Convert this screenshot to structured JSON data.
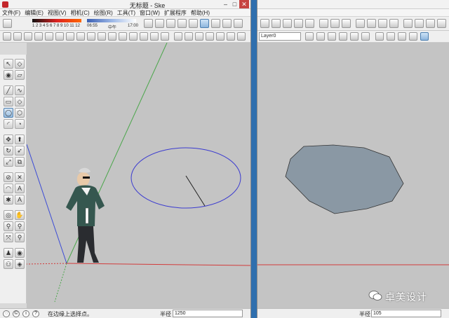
{
  "left_window": {
    "title": "无标题 - Ske",
    "menu": [
      "文件(F)",
      "编辑(E)",
      "视图(V)",
      "相机(C)",
      "绘图(R)",
      "工具(T)",
      "窗口(W)",
      "扩展程序",
      "帮助(H)"
    ],
    "scale_labels": {
      "a": "1 2 3 4 5 6 7 8 9 10 11 12",
      "b": "06:55",
      "c": "中午",
      "d": "17:00"
    },
    "status": {
      "hint": "在边缘上选择点。",
      "radius_label": "半径",
      "radius_value": "1250"
    }
  },
  "right_window": {
    "layer": "Layer0",
    "status": {
      "radius_label": "半径",
      "radius_value": "105"
    }
  },
  "watermark": {
    "text": "卓美设计"
  },
  "colors": {
    "axis_red": "#d23b3b",
    "axis_green": "#4aa64a",
    "axis_blue": "#3b4bd6",
    "circle": "#3b3bd0",
    "polygon_fill": "#8a98a4",
    "selection_bar": "#2f6fae"
  },
  "icons": {
    "window_close": "close-x",
    "minimize": "minimize-icon",
    "maximize": "maximize-icon"
  }
}
